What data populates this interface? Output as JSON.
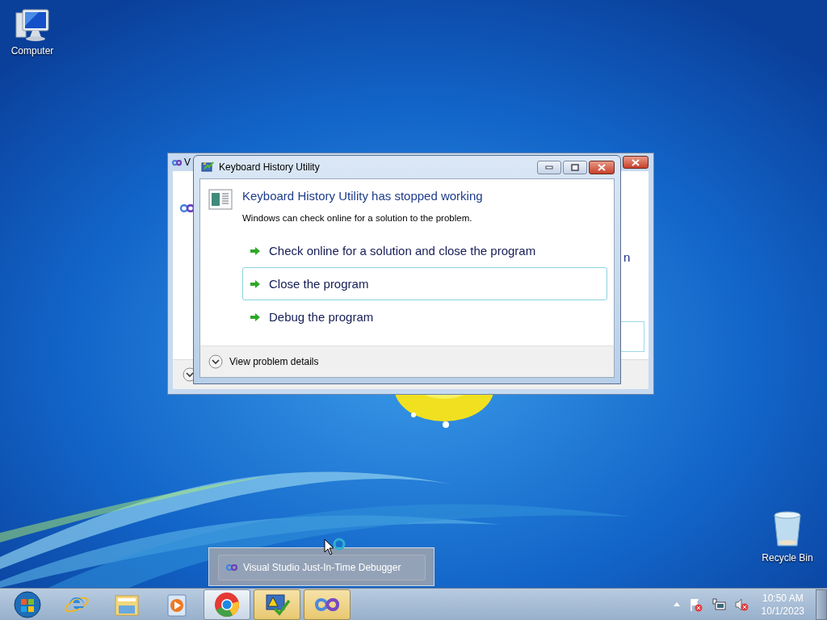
{
  "desktop": {
    "icons": [
      {
        "kind": "computer",
        "label": "Computer"
      },
      {
        "kind": "recycle",
        "label": "Recycle Bin"
      }
    ]
  },
  "background_window": {
    "title": "V",
    "text_fragment": "n",
    "details": {
      "expanded": false
    }
  },
  "dialog": {
    "title": "Keyboard History Utility",
    "heading": "Keyboard History Utility has stopped working",
    "message": "Windows can check online for a solution to the problem.",
    "options": [
      {
        "label": "Check online for a solution and close the program",
        "selected": false
      },
      {
        "label": "Close the program",
        "selected": true
      },
      {
        "label": "Debug the program",
        "selected": false
      }
    ],
    "details": {
      "label": "View problem details",
      "expanded": false
    }
  },
  "thumbnail": {
    "title": "Visual Studio Just-In-Time Debugger"
  },
  "taskbar": {
    "items": [
      {
        "kind": "start",
        "running": false,
        "flashing": false
      },
      {
        "kind": "ie",
        "running": false,
        "flashing": false
      },
      {
        "kind": "explorer",
        "running": false,
        "flashing": false
      },
      {
        "kind": "media",
        "running": false,
        "flashing": false
      },
      {
        "kind": "chrome",
        "running": true,
        "flashing": false
      },
      {
        "kind": "warning",
        "running": true,
        "flashing": true
      },
      {
        "kind": "vs",
        "running": true,
        "flashing": true
      }
    ],
    "tray": {
      "icons": [
        {
          "kind": "arrow"
        },
        {
          "kind": "flag"
        },
        {
          "kind": "network"
        },
        {
          "kind": "volume"
        }
      ],
      "time": "10:50 AM",
      "date": "10/1/2023"
    }
  }
}
